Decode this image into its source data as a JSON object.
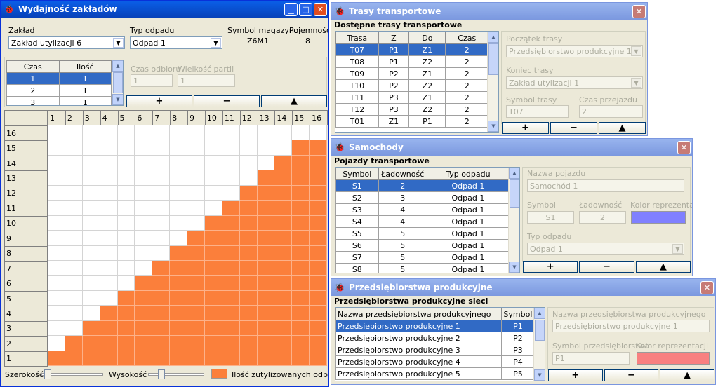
{
  "win1": {
    "title": "Wydajność zakładów",
    "zaklad_label": "Zakład",
    "zaklad_value": "Zakład utylizacji 6",
    "typ_label": "Typ odpadu",
    "typ_value": "Odpad 1",
    "symbol_label": "Symbol magazynu",
    "symbol_value": "Z6M1",
    "pojemnosc_label": "Pojemność",
    "pojemnosc_value": "8",
    "small_grid": {
      "headers": [
        "Czas",
        "Ilość"
      ],
      "rows": [
        [
          "1",
          "1"
        ],
        [
          "2",
          "1"
        ],
        [
          "3",
          "1"
        ]
      ],
      "selected": 0
    },
    "czas_odbioru_label": "Czas odbioru",
    "czas_odbioru_value": "1",
    "wielkosc_label": "Wielkość partii",
    "wielkosc_value": "1",
    "buttons": [
      "+",
      "−",
      "▲"
    ],
    "chart_data": {
      "type": "heatmap",
      "x_labels": [
        "1",
        "2",
        "3",
        "4",
        "5",
        "6",
        "7",
        "8",
        "9",
        "10",
        "11",
        "12",
        "13",
        "14",
        "15",
        "16"
      ],
      "y_labels": [
        "16",
        "15",
        "14",
        "13",
        "12",
        "11",
        "10",
        "9",
        "8",
        "7",
        "6",
        "5",
        "4",
        "3",
        "2",
        "1"
      ],
      "filled_cells_per_column": [
        1,
        2,
        3,
        4,
        5,
        6,
        7,
        8,
        9,
        10,
        11,
        12,
        13,
        14,
        15,
        15
      ],
      "fill_color": "#fb7f3b",
      "legend": "Ilość zutylizowanych odpadów"
    },
    "szerokosc_label": "Szerokość",
    "wysokosc_label": "Wysokość",
    "szerokosc_level": 0.05,
    "wysokosc_level": 0.2
  },
  "win2": {
    "title": "Trasy transportowe",
    "section": "Dostępne trasy transportowe",
    "headers": [
      "Trasa",
      "Z",
      "Do",
      "Czas"
    ],
    "rows": [
      [
        "T07",
        "P1",
        "Z1",
        "2"
      ],
      [
        "T08",
        "P1",
        "Z2",
        "2"
      ],
      [
        "T09",
        "P2",
        "Z1",
        "2"
      ],
      [
        "T10",
        "P2",
        "Z2",
        "2"
      ],
      [
        "T11",
        "P3",
        "Z1",
        "2"
      ],
      [
        "T12",
        "P3",
        "Z2",
        "2"
      ],
      [
        "T01",
        "Z1",
        "P1",
        "2"
      ]
    ],
    "selected": 0,
    "poczatek_label": "Początek trasy",
    "poczatek_value": "Przedsiębiorstwo produkcyjne 1",
    "koniec_label": "Koniec trasy",
    "koniec_value": "Zakład utylizacji 1",
    "symbol_label": "Symbol trasy",
    "symbol_value": "T07",
    "czas_label": "Czas przejazdu",
    "czas_value": "2",
    "buttons": [
      "+",
      "−",
      "▲"
    ]
  },
  "win3": {
    "title": "Samochody",
    "section": "Pojazdy transportowe",
    "headers": [
      "Symbol",
      "Ładowność",
      "Typ odpadu"
    ],
    "rows": [
      [
        "S1",
        "2",
        "Odpad 1"
      ],
      [
        "S2",
        "3",
        "Odpad 1"
      ],
      [
        "S3",
        "4",
        "Odpad 1"
      ],
      [
        "S4",
        "4",
        "Odpad 1"
      ],
      [
        "S5",
        "5",
        "Odpad 1"
      ],
      [
        "S6",
        "5",
        "Odpad 1"
      ],
      [
        "S7",
        "5",
        "Odpad 1"
      ],
      [
        "S8",
        "5",
        "Odpad 1"
      ]
    ],
    "selected": 0,
    "nazwa_label": "Nazwa pojazdu",
    "nazwa_value": "Samochód 1",
    "symbol_label": "Symbol",
    "symbol_value": "S1",
    "ladownosc_label": "Ładowność",
    "ladownosc_value": "2",
    "kolor_label": "Kolor reprezentacji",
    "kolor_value": "#8080ff",
    "typ_label": "Typ odpadu",
    "typ_value": "Odpad 1",
    "buttons": [
      "+",
      "−",
      "▲"
    ]
  },
  "win4": {
    "title": "Przedsiębiorstwa produkcyjne",
    "section": "Przedsiębiorstwa produkcyjne sieci",
    "headers": [
      "Nazwa przedsiębiorstwa produkcyjnego",
      "Symbol"
    ],
    "rows": [
      [
        "Przedsiębiorstwo produkcyjne 1",
        "P1"
      ],
      [
        "Przedsiębiorstwo produkcyjne 2",
        "P2"
      ],
      [
        "Przedsiębiorstwo produkcyjne 3",
        "P3"
      ],
      [
        "Przedsiębiorstwo produkcyjne 4",
        "P4"
      ],
      [
        "Przedsiębiorstwo produkcyjne 5",
        "P5"
      ]
    ],
    "selected": 0,
    "nazwa_label": "Nazwa przedsiębiorstwa produkcyjnego",
    "nazwa_value": "Przedsiębiorstwo produkcyjne 1",
    "symbol_label": "Symbol przedsiębiorstwa",
    "symbol_value": "P1",
    "kolor_label": "Kolor reprezentacji",
    "kolor_value": "#f88080",
    "buttons": [
      "+",
      "−",
      "▲"
    ]
  }
}
